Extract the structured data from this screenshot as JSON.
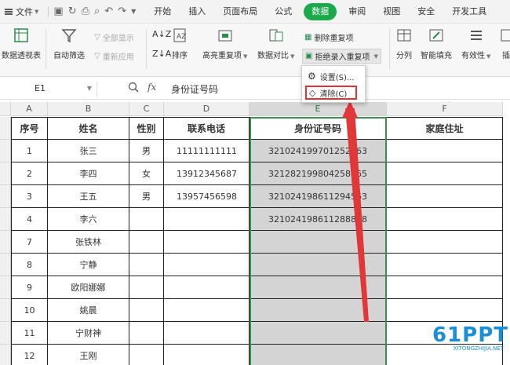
{
  "menubar": {
    "file": "文件",
    "tabs": [
      "开始",
      "插入",
      "页面布局",
      "公式",
      "数据",
      "审阅",
      "视图",
      "安全",
      "开发工具"
    ]
  },
  "ribbon": {
    "pivot": "数据透视表",
    "autofilter": "自动筛选",
    "show_all": "全部显示",
    "reapply": "重新应用",
    "sort": "排序",
    "highlight_dup": "高亮重复项",
    "data_compare": "数据对比",
    "remove_dup": "删除重复项",
    "reject_dup": "拒绝录入重复项",
    "split": "分列",
    "smart_fill": "智能填充",
    "validity": "有效性",
    "insert": "插"
  },
  "dropdown": {
    "settings": "设置(S)...",
    "clear": "清除(C)"
  },
  "formula_bar": {
    "name_box": "E1",
    "fx": "fx",
    "value": "身份证号码"
  },
  "columns": [
    "A",
    "B",
    "C",
    "D",
    "E",
    "F"
  ],
  "table": {
    "headers": [
      "序号",
      "姓名",
      "性别",
      "联系电话",
      "身份证号码",
      "家庭住址"
    ],
    "rows": [
      [
        "1",
        "张三",
        "男",
        "11111111111",
        "321024199701252863",
        ""
      ],
      [
        "2",
        "李四",
        "女",
        "13912345687",
        "321282199804258965",
        ""
      ],
      [
        "3",
        "王五",
        "男",
        "13957456598",
        "321024198611294563",
        ""
      ],
      [
        "4",
        "李六",
        "",
        "",
        "321024198611288888",
        ""
      ],
      [
        "7",
        "张铁林",
        "",
        "",
        "",
        ""
      ],
      [
        "8",
        "宁静",
        "",
        "",
        "",
        ""
      ],
      [
        "9",
        "欧阳娜娜",
        "",
        "",
        "",
        ""
      ],
      [
        "10",
        "姚晨",
        "",
        "",
        "",
        ""
      ],
      [
        "11",
        "宁财神",
        "",
        "",
        "",
        ""
      ],
      [
        "12",
        "王刚",
        "",
        "",
        "",
        ""
      ]
    ]
  },
  "watermark": {
    "brand": "61PPT",
    "url": "XITONGZHIJIA.NET"
  },
  "colors": {
    "accent": "#1ba94c",
    "selection": "#3c8d4f",
    "highlight": "#d33"
  }
}
